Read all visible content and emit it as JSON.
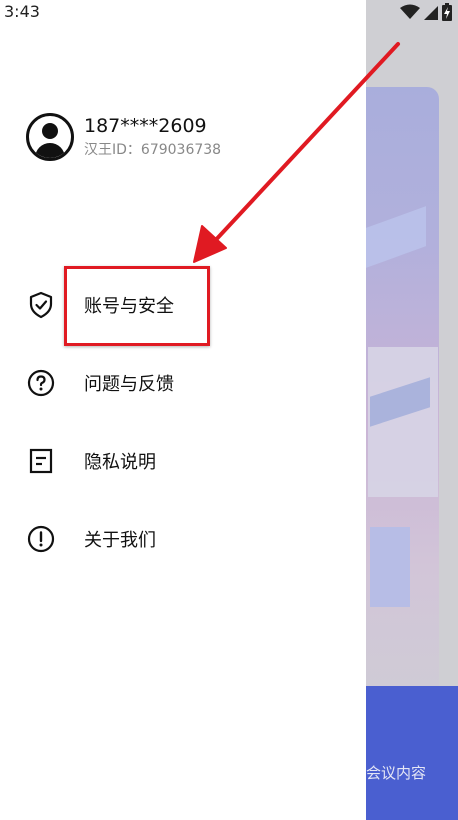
{
  "status_bar": {
    "time": "3:43",
    "icons": [
      "wifi-icon",
      "signal-icon",
      "battery-icon"
    ]
  },
  "profile": {
    "phone": "187****2609",
    "user_id": "汉王ID：679036738"
  },
  "menu": {
    "items": [
      {
        "label": "账号与安全",
        "icon": "shield-check-icon"
      },
      {
        "label": "问题与反馈",
        "icon": "question-icon"
      },
      {
        "label": "隐私说明",
        "icon": "document-icon"
      },
      {
        "label": "关于我们",
        "icon": "info-exclamation-icon"
      }
    ]
  },
  "background_app": {
    "bottom_text": "会议内容"
  },
  "colors": {
    "annotation_red": "#e01a22",
    "background_blue": "#4a5fd0",
    "dim_gray": "#cfcfd3"
  }
}
